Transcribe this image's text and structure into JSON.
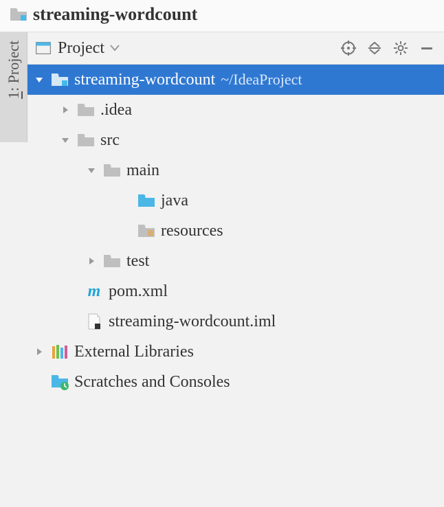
{
  "breadcrumb": {
    "project_name": "streaming-wordcount"
  },
  "side_tab": {
    "index": "1",
    "label": "Project"
  },
  "panel": {
    "view_selector": "Project",
    "actions": {
      "scroll_from_source": "scroll-from-source",
      "collapse_all": "collapse-all",
      "settings": "settings",
      "hide": "hide"
    }
  },
  "tree": {
    "root": {
      "name": "streaming-wordcount",
      "path": "~/IdeaProject"
    },
    "items": [
      {
        "label": ".idea"
      },
      {
        "label": "src"
      },
      {
        "label": "main"
      },
      {
        "label": "java"
      },
      {
        "label": "resources"
      },
      {
        "label": "test"
      },
      {
        "label": "pom.xml"
      },
      {
        "label": "streaming-wordcount.iml"
      },
      {
        "label": "External Libraries"
      },
      {
        "label": "Scratches and Consoles"
      }
    ]
  }
}
